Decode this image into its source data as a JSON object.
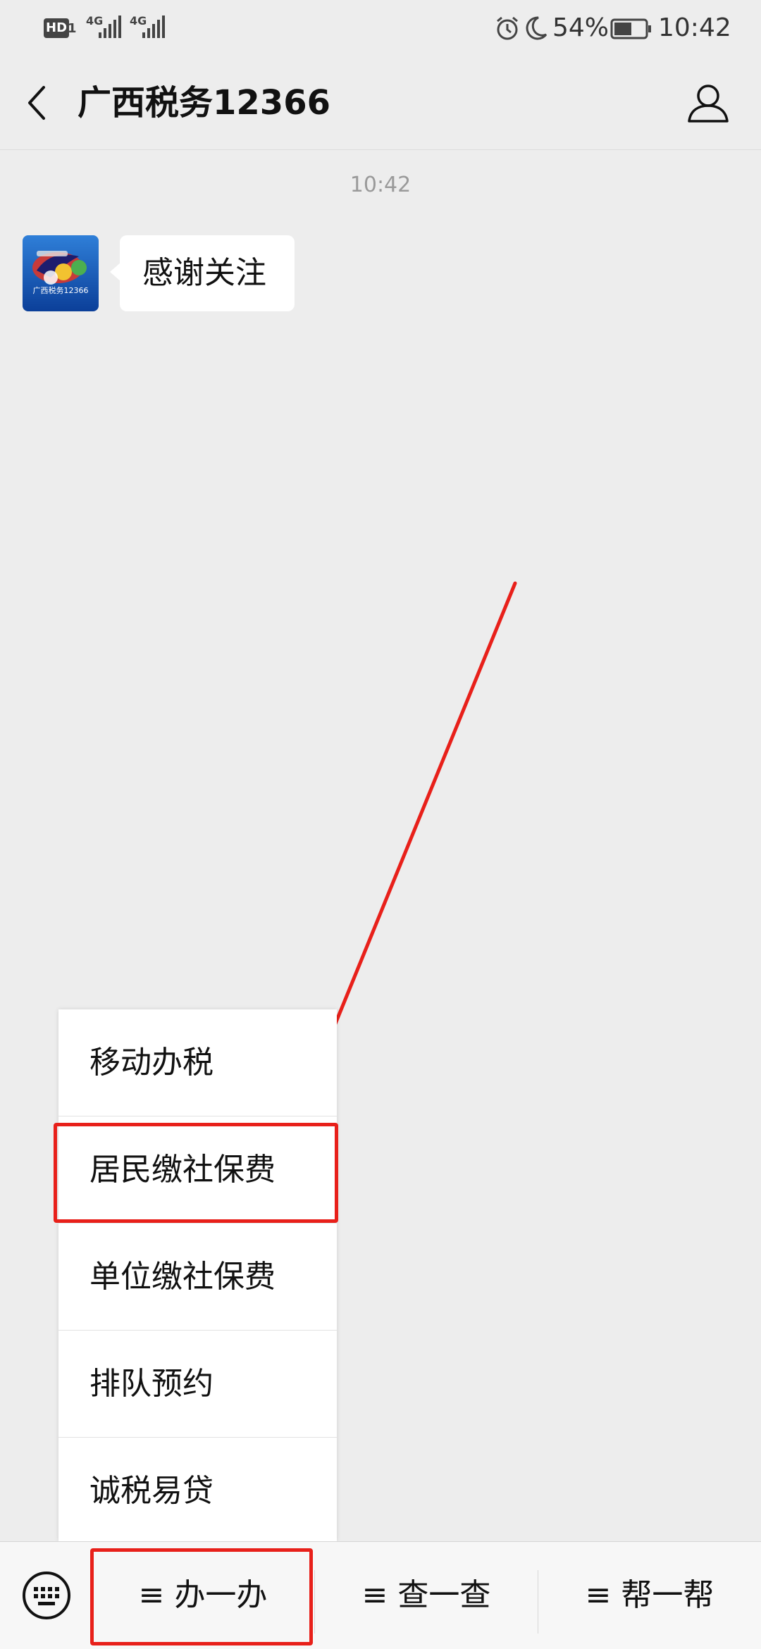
{
  "status_bar": {
    "hd_badge": "HD",
    "sim1": "1",
    "net1": "4G",
    "net2": "4G",
    "battery_percent": "54%",
    "time": "10:42",
    "icons": [
      "alarm-icon",
      "moon-icon",
      "battery-icon"
    ]
  },
  "header": {
    "title": "广西税务12366",
    "back_icon": "chevron-left-icon",
    "profile_icon": "person-icon"
  },
  "chat": {
    "timestamp": "10:42",
    "avatar_caption": "广西税务12366",
    "messages": [
      {
        "text": "感谢关注"
      }
    ]
  },
  "popup_menu": {
    "items": [
      {
        "label": "移动办税"
      },
      {
        "label": "居民缴社保费"
      },
      {
        "label": "单位缴社保费"
      },
      {
        "label": "排队预约"
      },
      {
        "label": "诚税易贷"
      }
    ]
  },
  "bottom_menu": {
    "keyboard_icon": "keyboard-icon",
    "tabs": [
      {
        "label": "≡ 办一办"
      },
      {
        "label": "≡ 查一查"
      },
      {
        "label": "≡ 帮一帮"
      }
    ]
  },
  "annotation_colors": {
    "highlight": "#e8201a"
  }
}
